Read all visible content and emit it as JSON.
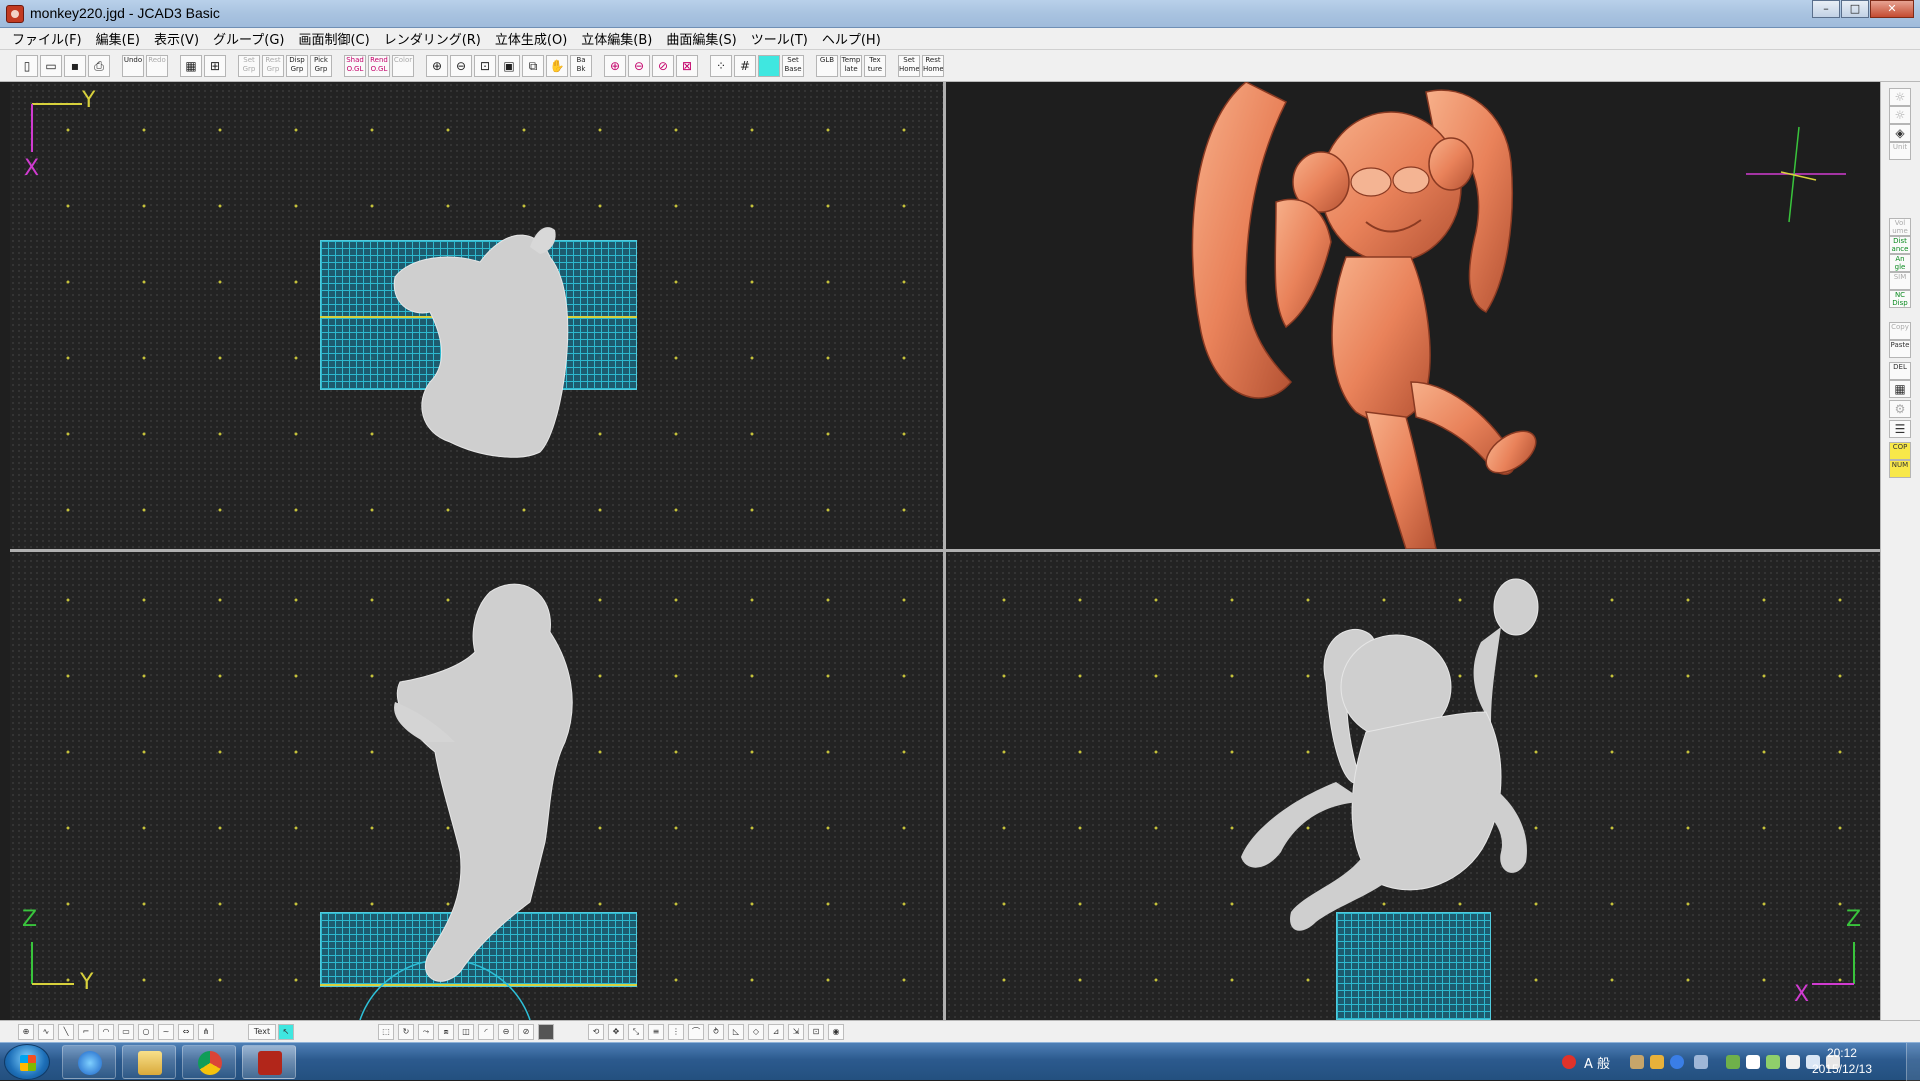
{
  "window": {
    "title": "monkey220.jgd - JCAD3 Basic",
    "controls": {
      "minimize": "–",
      "maximize": "□",
      "close": "✕"
    }
  },
  "menu": [
    "ファイル(F)",
    "編集(E)",
    "表示(V)",
    "グループ(G)",
    "画面制御(C)",
    "レンダリング(R)",
    "立体生成(O)",
    "立体編集(B)",
    "曲面編集(S)",
    "ツール(T)",
    "ヘルプ(H)"
  ],
  "toolbar": {
    "buttons": [
      {
        "name": "new-icon",
        "label": ""
      },
      {
        "name": "open-icon",
        "label": ""
      },
      {
        "name": "save-icon",
        "label": ""
      },
      {
        "name": "print-icon",
        "label": ""
      },
      {
        "name": "sep",
        "label": ""
      },
      {
        "name": "undo-button",
        "label": "Undo"
      },
      {
        "name": "redo-button",
        "label": "Redo"
      },
      {
        "name": "sep",
        "label": ""
      },
      {
        "name": "grid-view-icon",
        "label": ""
      },
      {
        "name": "quad-view-icon",
        "label": ""
      },
      {
        "name": "sep",
        "label": ""
      },
      {
        "name": "set-grp-button",
        "label": "Set Grp"
      },
      {
        "name": "rest-grp-button",
        "label": "Rest Grp"
      },
      {
        "name": "disp-grp-button",
        "label": "Disp Grp"
      },
      {
        "name": "pick-grp-button",
        "label": "Pick Grp"
      },
      {
        "name": "sep",
        "label": ""
      },
      {
        "name": "shad-ogl-button",
        "label": "Shad O.GL"
      },
      {
        "name": "rend-ogl-button",
        "label": "Rend O.GL"
      },
      {
        "name": "color-button",
        "label": "Color"
      },
      {
        "name": "sep",
        "label": ""
      },
      {
        "name": "zoom-in-icon",
        "label": ""
      },
      {
        "name": "zoom-out-icon",
        "label": ""
      },
      {
        "name": "zoom-fit-icon",
        "label": ""
      },
      {
        "name": "zoom-window-icon",
        "label": ""
      },
      {
        "name": "zoom-all-icon",
        "label": ""
      },
      {
        "name": "pan-hand-icon",
        "label": ""
      },
      {
        "name": "bk-button",
        "label": "Ba Bk"
      },
      {
        "name": "sep",
        "label": ""
      },
      {
        "name": "zoom-red-in-icon",
        "label": ""
      },
      {
        "name": "zoom-red-out-icon",
        "label": ""
      },
      {
        "name": "zoom-red-pick-icon",
        "label": ""
      },
      {
        "name": "zoom-red-fit-icon",
        "label": ""
      },
      {
        "name": "sep",
        "label": ""
      },
      {
        "name": "grid-dots-icon",
        "label": ""
      },
      {
        "name": "grid-lines-icon",
        "label": ""
      },
      {
        "name": "grid-snap-button",
        "label": ""
      },
      {
        "name": "set-base-button",
        "label": "Set Base"
      },
      {
        "name": "sep",
        "label": ""
      },
      {
        "name": "glb-button",
        "label": "GLB"
      },
      {
        "name": "template-button",
        "label": "Temp late"
      },
      {
        "name": "texture-button",
        "label": "Tex ture"
      },
      {
        "name": "sep",
        "label": ""
      },
      {
        "name": "set-home-button",
        "label": "Set Home"
      },
      {
        "name": "rest-home-button",
        "label": "Rest Home"
      }
    ]
  },
  "viewports": {
    "top_left": {
      "axis_v": "Y",
      "axis_h": "X"
    },
    "bottom_left": {
      "axis_v": "Z",
      "axis_h": "Y"
    },
    "bottom_right": {
      "axis_v": "Z",
      "axis_h": "X"
    }
  },
  "sidebar": {
    "buttons": [
      {
        "name": "light-icon",
        "label": "",
        "style": "dim"
      },
      {
        "name": "light2-icon",
        "label": "",
        "style": "dim"
      },
      {
        "name": "layer-icon",
        "label": "",
        "style": ""
      },
      {
        "name": "unit-button",
        "label": "Unit",
        "style": "dim"
      },
      {
        "name": "volume-button",
        "label": "Vol ume",
        "style": "dim"
      },
      {
        "name": "distance-button",
        "label": "Dist ance",
        "style": "green"
      },
      {
        "name": "angle-button",
        "label": "An gle",
        "style": "green"
      },
      {
        "name": "sim-button",
        "label": "SIM",
        "style": "dim"
      },
      {
        "name": "nc-disp-button",
        "label": "NC Disp",
        "style": "green"
      },
      {
        "name": "copy-button",
        "label": "Copy",
        "style": "dim"
      },
      {
        "name": "paste-button",
        "label": "Paste",
        "style": ""
      },
      {
        "name": "del-button",
        "label": "DEL",
        "style": ""
      },
      {
        "name": "table-icon",
        "label": "",
        "style": ""
      },
      {
        "name": "settings-icon",
        "label": "",
        "style": "dim"
      },
      {
        "name": "tree-icon",
        "label": "",
        "style": ""
      },
      {
        "name": "cop-button",
        "label": "COP",
        "style": "yellow"
      },
      {
        "name": "num-button",
        "label": "NUM",
        "style": "yellow"
      }
    ]
  },
  "bottombar": {
    "text_button": "Text"
  },
  "taskbar": {
    "clock_time": "20:12",
    "clock_date": "2015/12/13",
    "ime_mode": "A 般"
  },
  "colors": {
    "viewport_bg": "#232323",
    "grid_plate": "#2ec0d8",
    "model_gray": "#cfcfcf",
    "render_copper": "#e9825a",
    "axis_y_color": "#d8d13c",
    "axis_x_color": "#d03bd0",
    "axis_z_color": "#39c43c"
  }
}
